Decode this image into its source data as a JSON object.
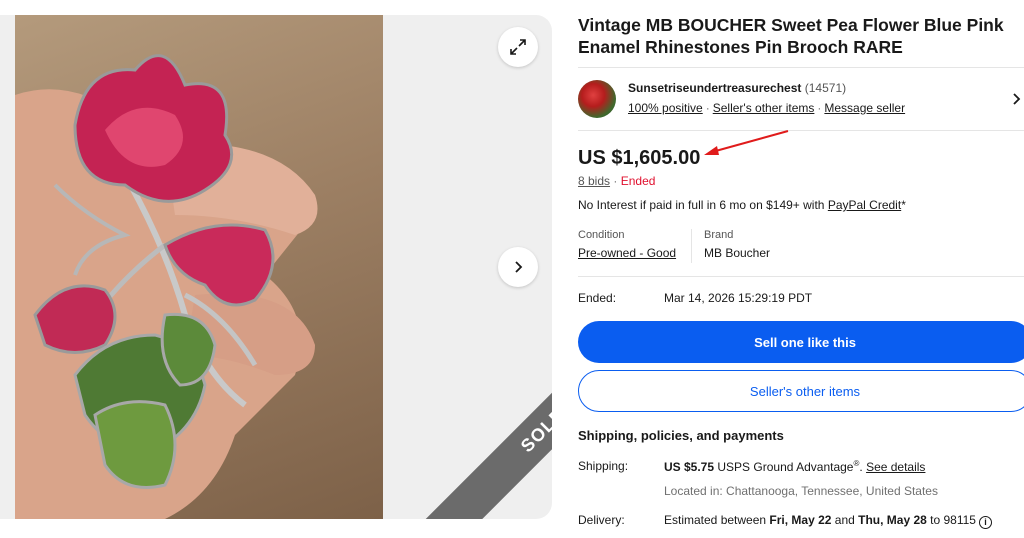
{
  "listing": {
    "title": "Vintage MB BOUCHER Sweet Pea Flower Blue Pink Enamel Rhinestones Pin Brooch RARE",
    "sold_banner": "SOLD"
  },
  "seller": {
    "name": "Sunsetriseundertreasurechest",
    "feedback_count": "(14571)",
    "positive": "100% positive",
    "other_items_link": "Seller's other items",
    "message_link": "Message seller"
  },
  "price": {
    "amount": "US $1,605.00",
    "bids": "8 bids",
    "separator": "·",
    "status": "Ended"
  },
  "financing": {
    "text": "No Interest if paid in full in 6 mo on $149+ with ",
    "link": "PayPal Credit",
    "suffix": "*"
  },
  "specs": {
    "condition_label": "Condition",
    "condition_value": "Pre-owned - Good",
    "brand_label": "Brand",
    "brand_value": "MB Boucher"
  },
  "ended": {
    "label": "Ended:",
    "value": "Mar 14, 2026 15:29:19 PDT"
  },
  "buttons": {
    "primary": "Sell one like this",
    "secondary": "Seller's other items"
  },
  "shipping": {
    "heading": "Shipping, policies, and payments",
    "label": "Shipping:",
    "cost": "US $5.75",
    "service": " USPS Ground Advantage",
    "reg": "®",
    "see_details": "See details",
    "located": "Located in: Chattanooga, Tennessee, United States",
    "delivery_label": "Delivery:",
    "delivery_prefix": "Estimated between ",
    "delivery_start": "Fri, May 22",
    "delivery_and": " and ",
    "delivery_end": "Thu, May 28",
    "delivery_to": " to 98115"
  },
  "colors": {
    "accent": "#0a5df0",
    "ended": "#e0102e",
    "annotation_arrow": "#e01b1b"
  },
  "icons": {
    "expand": "expand-icon",
    "next": "chevron-right-icon",
    "seller_chevron": "chevron-right-icon",
    "info": "info-icon"
  }
}
